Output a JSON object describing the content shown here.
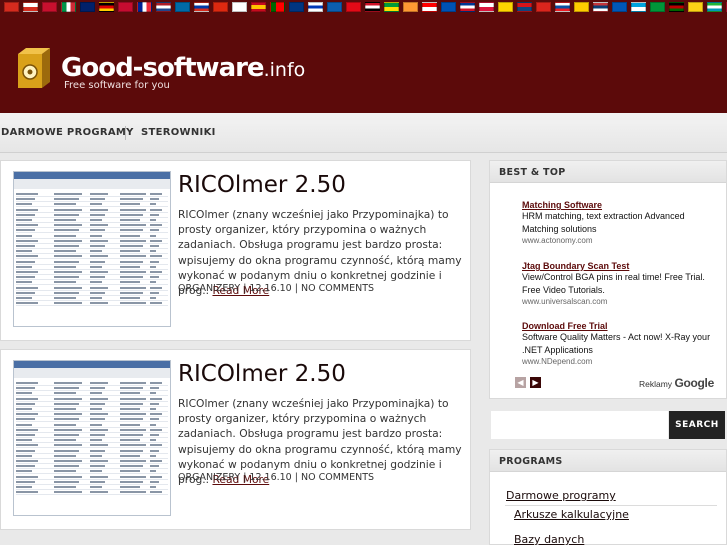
{
  "colors": {
    "brand": "#5c0a0a",
    "link": "#5c0a0a",
    "flagbar": "#5a0b0b"
  },
  "site": {
    "name": "Good-software",
    "tld": ".info",
    "tagline": "Free software for you"
  },
  "nav": {
    "items": [
      "DARMOWE PROGRAMY",
      "STEROWNIKI"
    ]
  },
  "posts": [
    {
      "title": "RICOlmer 2.50",
      "excerpt": "RICOlmer (znany wcześniej jako Przypominajka) to prosty organizer, który przypomina o ważnych zadaniach. Obsługa programu jest bardzo prosta: wpisujemy do okna programu czynność, którą mamy wykonać w podanym dniu o konkretnej godzinie i prog..",
      "read_more": "Read More",
      "category": "ORGANIZERY",
      "date": "12.16.10",
      "comments": "NO COMMENTS",
      "sep": "|"
    },
    {
      "title": "RICOlmer 2.50",
      "excerpt": "RICOlmer (znany wcześniej jako Przypominajka) to prosty organizer, który przypomina o ważnych zadaniach. Obsługa programu jest bardzo prosta: wpisujemy do okna programu czynność, którą mamy wykonać w podanym dniu o konkretnej godzinie i prog..",
      "read_more": "Read More",
      "category": "ORGANIZERY",
      "date": "12.16.10",
      "comments": "NO COMMENTS",
      "sep": "|"
    }
  ],
  "sidebar": {
    "best_top": {
      "title": "BEST & TOP",
      "ads": [
        {
          "title": "Matching Software",
          "desc": "HRM matching, text extraction Advanced Matching solutions",
          "url": "www.actonomy.com"
        },
        {
          "title": "Jtag Boundary Scan Test",
          "desc": "View/Control BGA pins in real time! Free Trial. Free Video Tutorials.",
          "url": "www.universalscan.com"
        },
        {
          "title": "Download Free Trial",
          "desc": "Software Quality Matters - Act now! X-Ray your .NET Applications",
          "url": "www.NDepend.com"
        }
      ],
      "reklamy": "Reklamy",
      "google": "Google",
      "prev_icon": "chevron-left-icon",
      "next_icon": "chevron-right-icon"
    },
    "search": {
      "button": "SEARCH",
      "value": ""
    },
    "programs": {
      "title": "PROGRAMS",
      "items": [
        "Darmowe programy",
        "Arkusze kalkulacyjne",
        "Bazy danych"
      ]
    }
  }
}
